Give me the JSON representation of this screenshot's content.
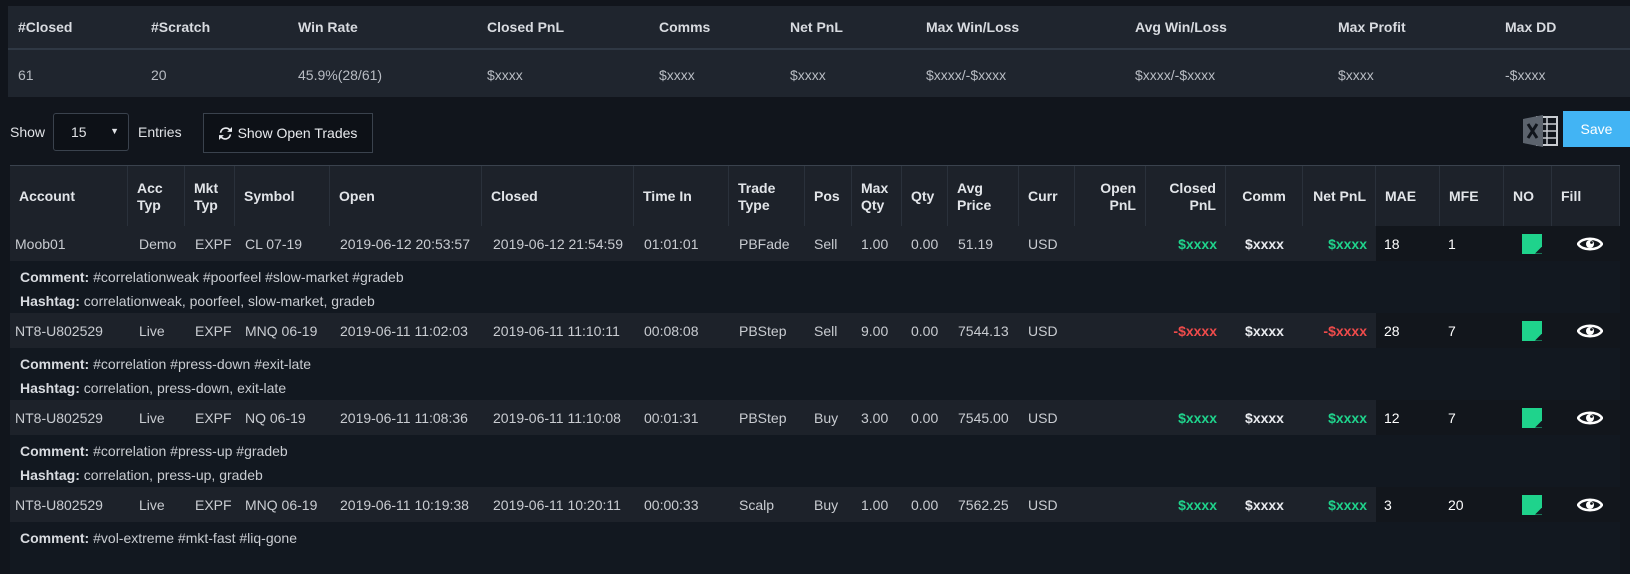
{
  "summary": {
    "headers": [
      "#Closed",
      "#Scratch",
      "Win Rate",
      "Closed PnL",
      "Comms",
      "Net PnL",
      "Max Win/Loss",
      "Avg Win/Loss",
      "Max Profit",
      "Max DD"
    ],
    "values": [
      "61",
      "20",
      "45.9%(28/61)",
      "$xxxx",
      "$xxxx",
      "$xxxx",
      "$xxxx/-$xxxx",
      "$xxxx/-$xxxx",
      "$xxxx",
      "-$xxxx"
    ]
  },
  "toolbar": {
    "show_label": "Show",
    "entries_value": "15",
    "entries_label": "Entries",
    "open_trades_label": "Show Open Trades",
    "save_label": "Save"
  },
  "columns": [
    "Account",
    "Acc Typ",
    "Mkt Typ",
    "Symbol",
    "Open",
    "Closed",
    "Time In",
    "Trade Type",
    "Pos",
    "Max Qty",
    "Qty",
    "Avg Price",
    "Curr",
    "Open PnL",
    "Closed PnL",
    "Comm",
    "Net PnL",
    "MAE",
    "MFE",
    "NO",
    "Fill"
  ],
  "comment_label": "Comment:",
  "hashtag_label": "Hashtag:",
  "trades": [
    {
      "account": "Moob01",
      "acc_typ": "Demo",
      "mkt_typ": "EXPF",
      "symbol": "CL 07-19",
      "open": "2019-06-12 20:53:57",
      "closed": "2019-06-12 21:54:59",
      "time_in": "01:01:01",
      "trade_type": "PBFade",
      "pos": "Sell",
      "max_qty": "1.00",
      "qty": "0.00",
      "avg_price": "51.19",
      "curr": "USD",
      "open_pnl": "",
      "closed_pnl": "$xxxx",
      "comm": "$xxxx",
      "net_pnl": "$xxxx",
      "mae": "18",
      "mfe": "1",
      "comment": " #correlationweak #poorfeel #slow-market #gradeb",
      "hashtag": " correlationweak, poorfeel, slow-market, gradeb"
    },
    {
      "account": "NT8-U802529",
      "acc_typ": "Live",
      "mkt_typ": "EXPF",
      "symbol": "MNQ 06-19",
      "open": "2019-06-11 11:02:03",
      "closed": "2019-06-11 11:10:11",
      "time_in": "00:08:08",
      "trade_type": "PBStep",
      "pos": "Sell",
      "max_qty": "9.00",
      "qty": "0.00",
      "avg_price": "7544.13",
      "curr": "USD",
      "open_pnl": "",
      "closed_pnl": "-$xxxx",
      "comm": "$xxxx",
      "net_pnl": "-$xxxx",
      "mae": "28",
      "mfe": "7",
      "comment": " #correlation #press-down #exit-late",
      "hashtag": " correlation, press-down, exit-late"
    },
    {
      "account": "NT8-U802529",
      "acc_typ": "Live",
      "mkt_typ": "EXPF",
      "symbol": "NQ 06-19",
      "open": "2019-06-11 11:08:36",
      "closed": "2019-06-11 11:10:08",
      "time_in": "00:01:31",
      "trade_type": "PBStep",
      "pos": "Buy",
      "max_qty": "3.00",
      "qty": "0.00",
      "avg_price": "7545.00",
      "curr": "USD",
      "open_pnl": "",
      "closed_pnl": "$xxxx",
      "comm": "$xxxx",
      "net_pnl": "$xxxx",
      "mae": "12",
      "mfe": "7",
      "comment": " #correlation #press-up #gradeb",
      "hashtag": " correlation, press-up, gradeb"
    },
    {
      "account": "NT8-U802529",
      "acc_typ": "Live",
      "mkt_typ": "EXPF",
      "symbol": "MNQ 06-19",
      "open": "2019-06-11 10:19:38",
      "closed": "2019-06-11 10:20:11",
      "time_in": "00:00:33",
      "trade_type": "Scalp",
      "pos": "Buy",
      "max_qty": "1.00",
      "qty": "0.00",
      "avg_price": "7562.25",
      "curr": "USD",
      "open_pnl": "",
      "closed_pnl": "$xxxx",
      "comm": "$xxxx",
      "net_pnl": "$xxxx",
      "mae": "3",
      "mfe": "20",
      "comment": " #vol-extreme #mkt-fast #liq-gone",
      "hashtag": ""
    }
  ],
  "icons": {
    "refresh": "refresh-icon",
    "excel": "excel-icon",
    "note": "note-icon",
    "eye": "eye-icon",
    "caret": "caret-down-icon"
  },
  "colors": {
    "positive": "#1fd38c",
    "negative": "#f04b4b",
    "save": "#42b4f4",
    "note": "#1fd38c"
  }
}
